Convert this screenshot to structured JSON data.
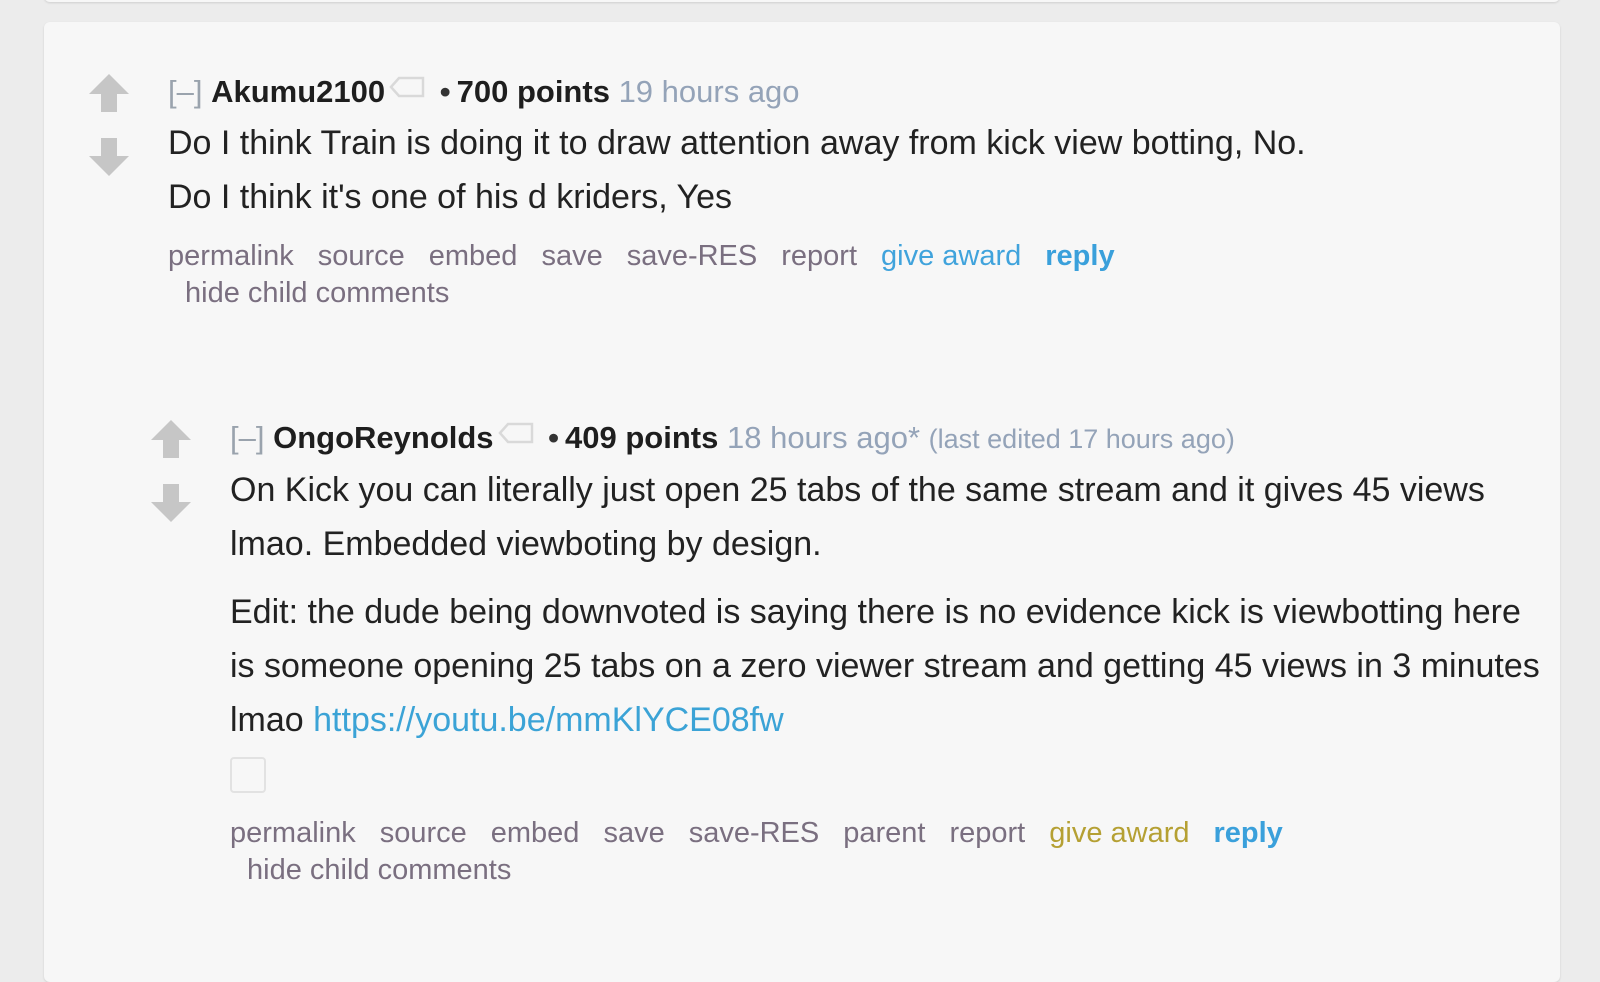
{
  "comments": [
    {
      "expand": "[–]",
      "author": "Akumu2100",
      "bullet": "•",
      "score": "700 points",
      "time": "19 hours ago",
      "edited": "",
      "paragraphs": [
        "Do I think Train is doing it to draw attention away from kick view botting, No.",
        "Do I think it's one of his d   kriders, Yes"
      ],
      "buttons": {
        "permalink": "permalink",
        "source": "source",
        "embed": "embed",
        "save": "save",
        "save_res": "save-RES",
        "report": "report",
        "give_award": "give award",
        "reply": "reply",
        "hide_child": "hide child comments"
      }
    },
    {
      "expand": "[–]",
      "author": "OngoReynolds",
      "bullet": "•",
      "score": "409 points",
      "time": "18 hours ago*",
      "edited": "(last edited 17 hours ago)",
      "paragraphs": [
        "On Kick you can literally just open 25 tabs of the same stream and it gives 45 views lmao. Embedded viewboting by design.",
        "Edit: the dude being downvoted is saying there is no evidence kick is viewbotting here is someone opening 25 tabs on a zero viewer stream and getting 45 views in 3 minutes lmao "
      ],
      "link": "https://youtu.be/mmKlYCE08fw",
      "buttons": {
        "permalink": "permalink",
        "source": "source",
        "embed": "embed",
        "save": "save",
        "save_res": "save-RES",
        "parent": "parent",
        "report": "report",
        "give_award": "give award",
        "reply": "reply",
        "hide_child": "hide child comments"
      }
    }
  ],
  "icons": {
    "upvote": "upvote-arrow-icon",
    "downvote": "downvote-arrow-icon",
    "user_tag": "user-tag-icon"
  },
  "colors": {
    "link": "#3ba3d6",
    "reply": "#3aa0db",
    "award_blue": "#40a3dc",
    "award_gold": "#b5a033",
    "arrow_gray": "#c6c6c6"
  }
}
